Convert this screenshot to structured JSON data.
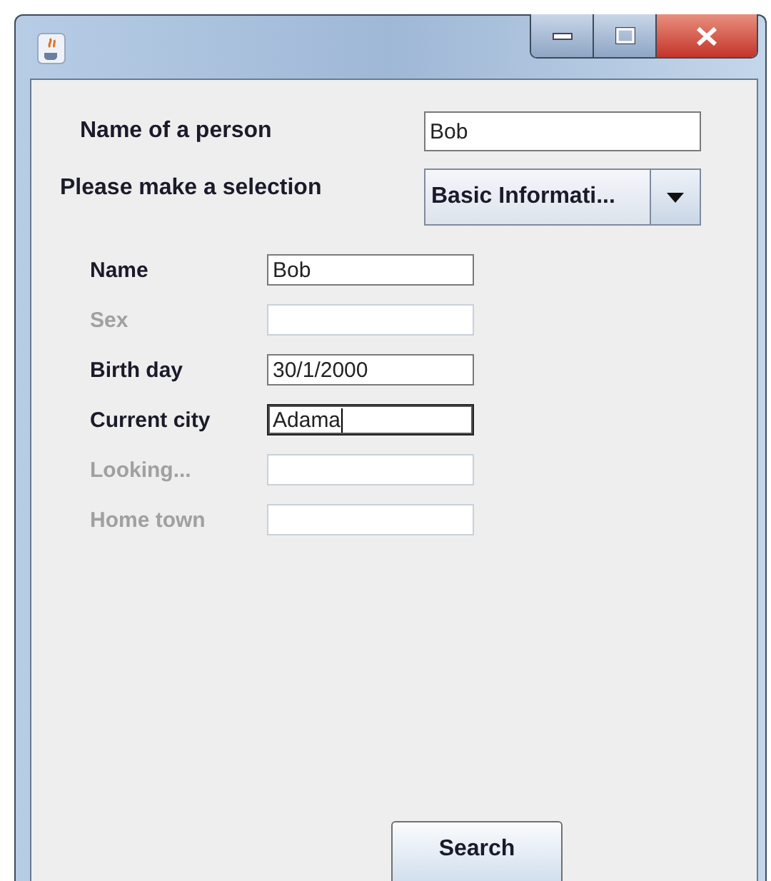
{
  "person": {
    "label": "Name of a person",
    "value": "Bob"
  },
  "selection": {
    "label": "Please make a selection",
    "value": "Basic Informati..."
  },
  "fields": [
    {
      "label": "Name",
      "value": "Bob",
      "disabled": false,
      "focused": false
    },
    {
      "label": "Sex",
      "disabled": true,
      "focused": false
    },
    {
      "label": "Birth day",
      "value": "30/1/2000",
      "disabled": false,
      "focused": false
    },
    {
      "label": "Current city",
      "value": "Adama",
      "disabled": false,
      "focused": true
    },
    {
      "label": "Looking...",
      "disabled": true,
      "focused": false
    },
    {
      "label": "Home town",
      "disabled": true,
      "focused": false
    }
  ],
  "search_button": {
    "label": "Search"
  }
}
